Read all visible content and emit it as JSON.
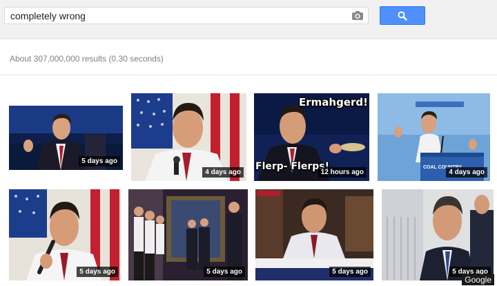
{
  "search": {
    "query": "completely wrong",
    "camera_icon": "camera-icon",
    "button_icon": "magnifier-icon"
  },
  "results": {
    "stats": "About 307,000,000 results (0.30 seconds)"
  },
  "images": [
    {
      "age": "5 days ago"
    },
    {
      "age": "4 days ago"
    },
    {
      "age": "12 hours ago",
      "caption_top": "Ermahgerd!",
      "caption_bottom": "Flerp- Flerps!"
    },
    {
      "age": "4 days ago",
      "sign_text": "COAL COUNTRY"
    },
    {
      "age": "5 days ago"
    },
    {
      "age": "5 days ago"
    },
    {
      "age": "5 days ago"
    },
    {
      "age": "5 days ago"
    }
  ],
  "watermark": "Google",
  "colors": {
    "search_button": "#4d90fe",
    "topbar": "#f1f1f1"
  }
}
